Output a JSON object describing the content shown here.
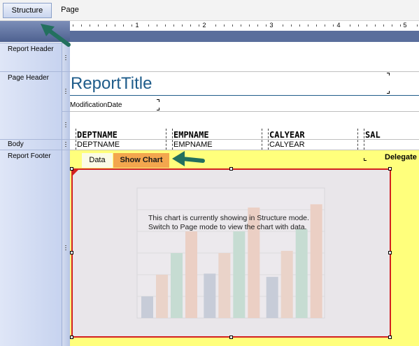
{
  "modes": {
    "structure": "Structure",
    "page": "Page"
  },
  "ruler": {
    "marks": [
      "1",
      "2",
      "3",
      "4",
      "5"
    ]
  },
  "sections": {
    "report_header": "Report Header",
    "page_header": "Page Header",
    "body": "Body",
    "report_footer": "Report Footer"
  },
  "report": {
    "title": "ReportTitle",
    "modification_date": "ModificationDate",
    "columns": [
      {
        "header": "DEPTNAME",
        "value": "DEPTNAME"
      },
      {
        "header": "EMPNAME",
        "value": "EMPNAME"
      },
      {
        "header": "CALYEAR",
        "value": "CALYEAR"
      },
      {
        "header": "SAL",
        "value": ""
      }
    ],
    "delegate": "Delegate"
  },
  "chart_tabs": {
    "data": "Data",
    "show_chart": "Show Chart"
  },
  "chart_note": {
    "line1": "This chart is currently showing in Structure mode.",
    "line2": "Switch to Page mode to view the chart with data."
  },
  "chart_data": {
    "type": "bar",
    "categories": [
      "",
      "",
      ""
    ],
    "series": [
      {
        "values": [
          2,
          4.1,
          3.8
        ],
        "color": "#c7ccd8"
      },
      {
        "values": [
          4,
          6,
          6.2
        ],
        "color": "#ead3c9"
      },
      {
        "values": [
          6,
          8,
          8.2
        ],
        "color": "#c6dcd2"
      },
      {
        "values": [
          8,
          10.2,
          10.5
        ],
        "color": "#ebcfc4"
      }
    ],
    "ylim": [
      0,
      12
    ],
    "grid": true
  },
  "colors": {
    "accent_tab": "#f3a64e",
    "footer": "#ffff7c",
    "selection": "#d22020",
    "arrow": "#23705e"
  }
}
